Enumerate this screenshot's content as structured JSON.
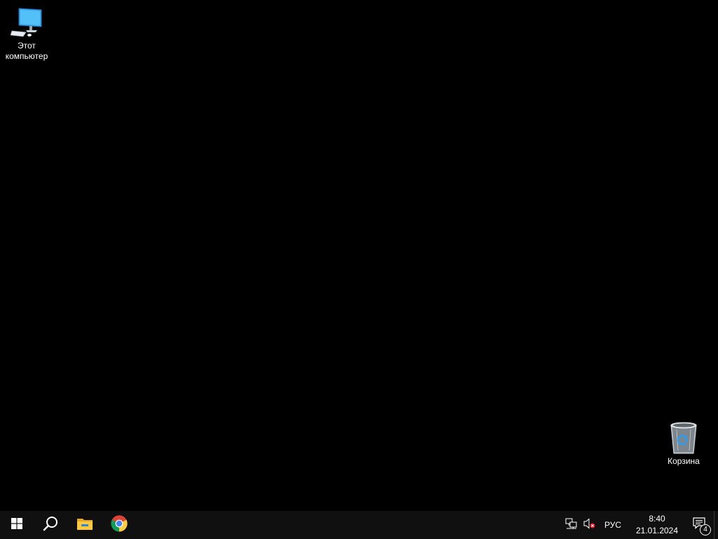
{
  "desktop": {
    "background_color": "#000000",
    "icons": [
      {
        "label": "Этот\nкомпьютер",
        "icon": "this-pc-icon"
      },
      {
        "label": "Корзина",
        "icon": "recycle-bin-icon"
      }
    ]
  },
  "taskbar": {
    "background_color": "#101010",
    "start": {
      "icon": "windows-start-icon"
    },
    "search": {
      "icon": "search-icon"
    },
    "pinned": [
      {
        "icon": "file-explorer-icon"
      },
      {
        "icon": "chrome-icon"
      }
    ],
    "tray": {
      "network_icon": "network-icon",
      "volume_icon": "volume-muted-icon",
      "language": "РУС",
      "time": "8:40",
      "date": "21.01.2024",
      "notifications_icon": "action-center-icon",
      "notifications_count": "4"
    }
  }
}
